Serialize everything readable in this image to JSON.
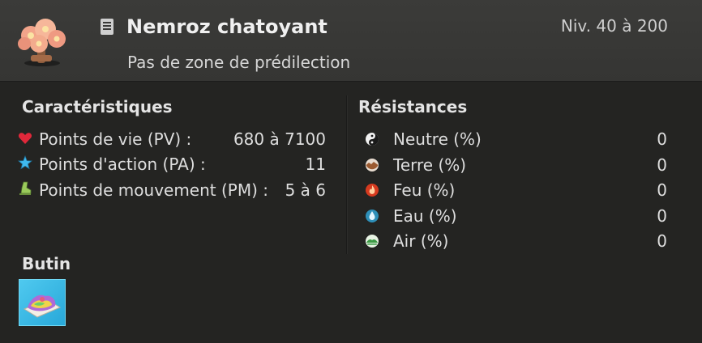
{
  "header": {
    "name": "Nemroz chatoyant",
    "level": "Niv. 40 à 200",
    "zone": "Pas de zone de prédilection",
    "icons": {
      "monster": "flower-tree-icon",
      "book": "book-icon"
    }
  },
  "characteristics": {
    "title": "Caractéristiques",
    "items": [
      {
        "icon": "heart-icon",
        "label": "Points de vie (PV) :",
        "value": "680 à 7100"
      },
      {
        "icon": "star-icon",
        "label": "Points d'action (PA) :",
        "value": "11"
      },
      {
        "icon": "boot-icon",
        "label": "Points de mouvement (PM) :",
        "value": "5 à 6"
      }
    ]
  },
  "resistances": {
    "title": "Résistances",
    "items": [
      {
        "icon": "neutral-element-icon",
        "label": "Neutre (%)",
        "value": "0"
      },
      {
        "icon": "earth-element-icon",
        "label": "Terre (%)",
        "value": "0"
      },
      {
        "icon": "fire-element-icon",
        "label": "Feu (%)",
        "value": "0"
      },
      {
        "icon": "water-element-icon",
        "label": "Eau (%)",
        "value": "0"
      },
      {
        "icon": "air-element-icon",
        "label": "Air (%)",
        "value": "0"
      }
    ]
  },
  "loot": {
    "title": "Butin",
    "items": [
      {
        "icon": "loot-item-icon"
      }
    ]
  },
  "colors": {
    "background": "#262624",
    "header_background": "#393937",
    "text": "#e6e6e6",
    "loot_frame": "#3cbde8"
  }
}
